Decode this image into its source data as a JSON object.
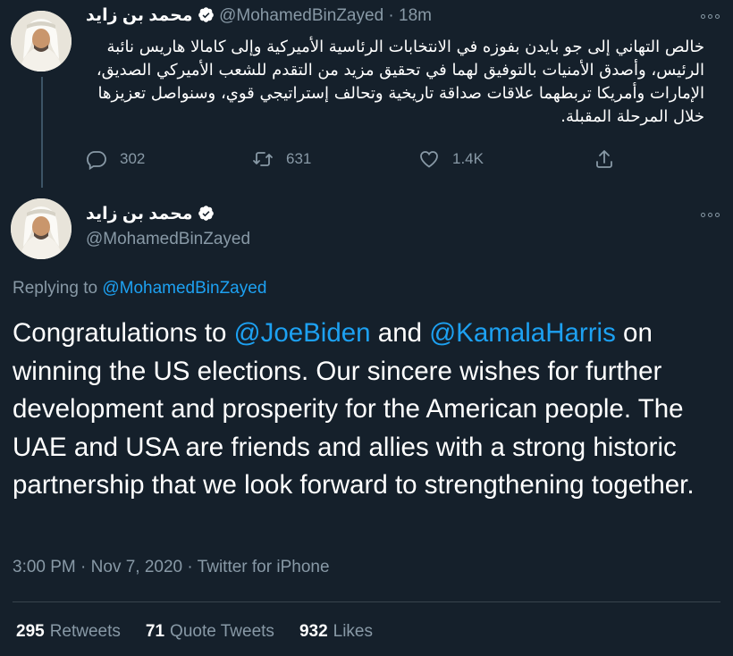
{
  "tweet1": {
    "name": "محمد بن زايد",
    "handle": "@MohamedBinZayed",
    "separator": "·",
    "time": "18m",
    "text": "خالص التهاني إلى جو بايدن بفوزه في الانتخابات الرئاسية الأميركية وإلى كامالا هاريس نائبة الرئيس، وأصدق الأمنيات بالتوفيق لهما في تحقيق مزيد من التقدم للشعب الأميركي الصديق، الإمارات وأمريكا تربطهما علاقات صداقة تاريخية وتحالف إستراتيجي قوي، وسنواصل تعزيزها خلال المرحلة المقبلة.",
    "actions": {
      "replies": "302",
      "retweets": "631",
      "likes": "1.4K"
    }
  },
  "tweet2": {
    "name": "محمد بن زايد",
    "handle": "@MohamedBinZayed",
    "replying_prefix": "Replying to ",
    "replying_handle": "@MohamedBinZayed",
    "text_parts": {
      "p1": "Congratulations to ",
      "mention1": "@JoeBiden",
      "p2": " and ",
      "mention2": "@KamalaHarris",
      "p3": " on winning the US elections. Our sincere wishes for further development and prosperity for the American people. The UAE and USA are friends and allies with a strong historic partnership that we look forward to strengthening together."
    },
    "meta": {
      "time": "3:00 PM",
      "sep": " · ",
      "date": "Nov 7, 2020",
      "source": "Twitter for iPhone"
    },
    "stats": {
      "retweets_count": "295",
      "retweets_label": "Retweets",
      "quotes_count": "71",
      "quotes_label": "Quote Tweets",
      "likes_count": "932",
      "likes_label": "Likes"
    }
  },
  "icons": {
    "verified": "verified-badge-icon",
    "more": "more-icon",
    "reply": "reply-icon",
    "retweet": "retweet-icon",
    "like": "heart-icon",
    "share": "share-icon"
  },
  "colors": {
    "background": "#15202b",
    "accent": "#1da1f2",
    "muted": "#8899a6",
    "divider": "#38444d"
  }
}
